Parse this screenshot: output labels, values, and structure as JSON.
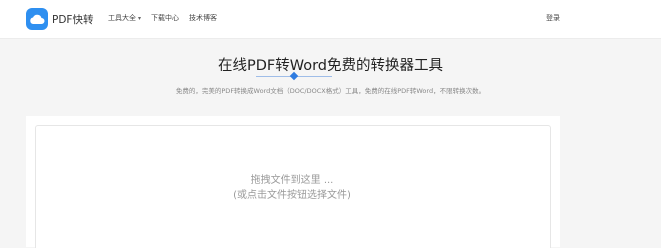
{
  "header": {
    "logo_text": "PDF快转",
    "nav": [
      {
        "label": "工具大全"
      },
      {
        "label": "下载中心"
      },
      {
        "label": "技术博客"
      }
    ],
    "login_label": "登录"
  },
  "hero": {
    "title": "在线PDF转Word免费的转换器工具",
    "subtitle": "免费的，完美的PDF转换成Word文档（DOC/DOCX格式）工具，免费的在线PDF转Word，不限转换次数。"
  },
  "upload": {
    "drop_text": "拖拽文件到这里 ...",
    "click_text": "(或点击文件按钮选择文件)"
  },
  "colors": {
    "brand": "#2e8ff0",
    "accent": "#2e7be0"
  }
}
